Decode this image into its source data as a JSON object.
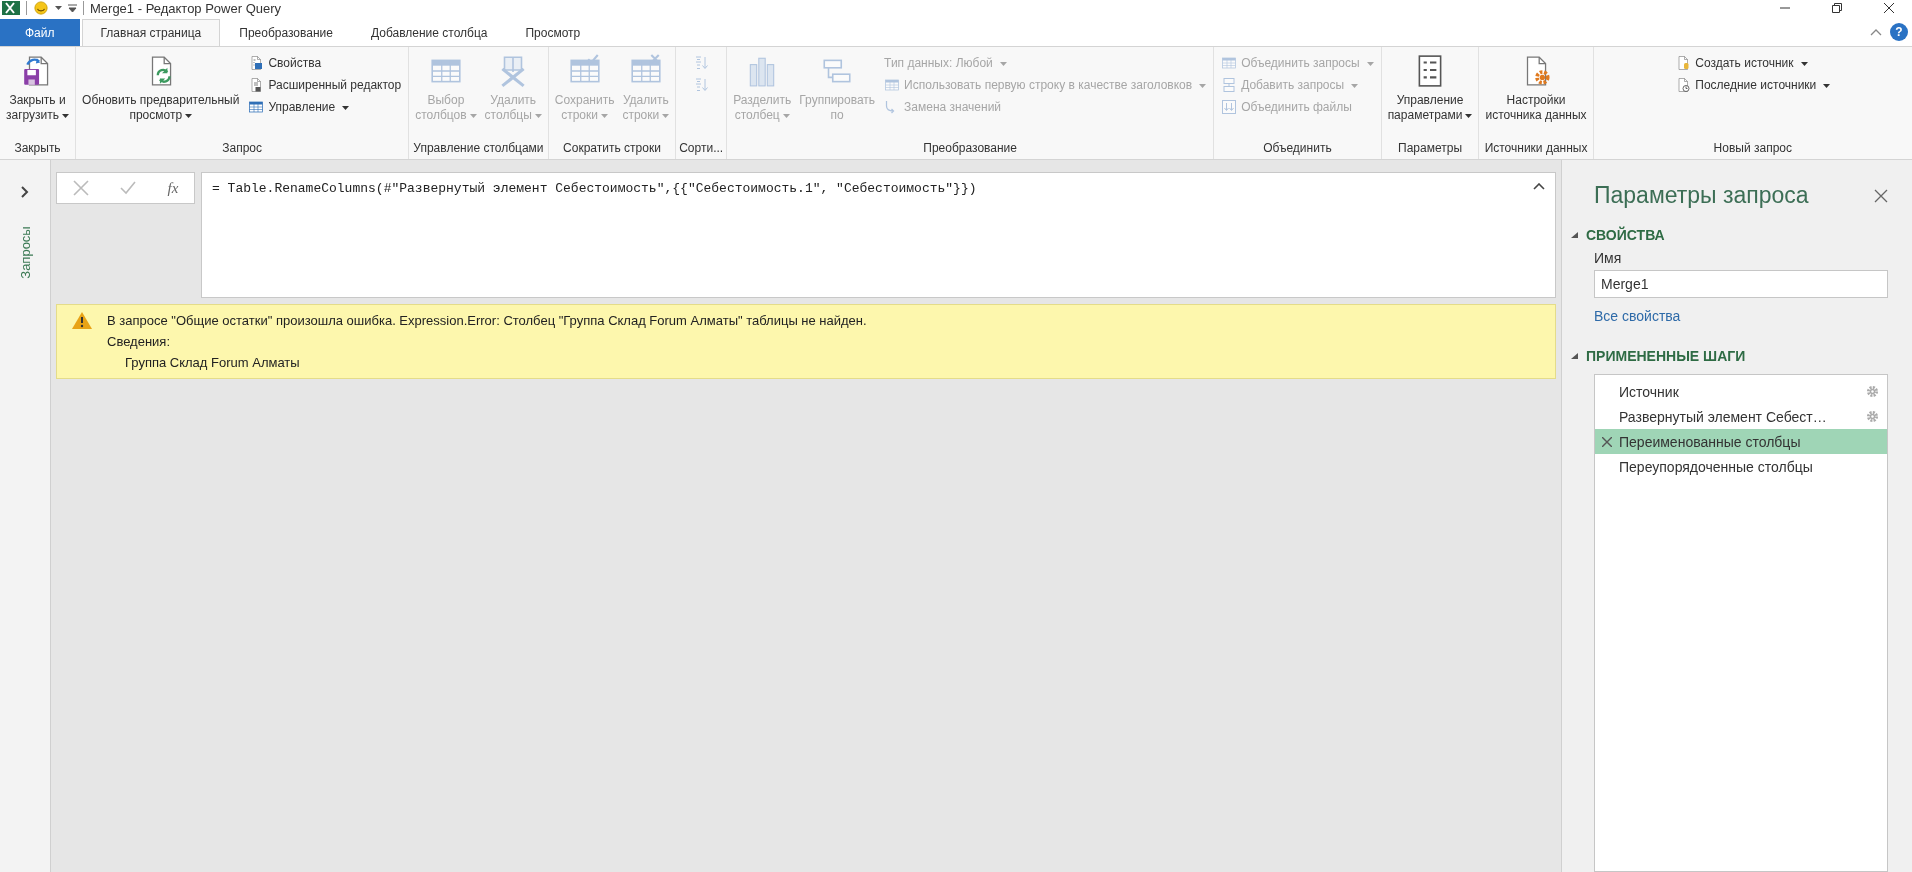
{
  "window": {
    "title": "Merge1 - Редактор Power Query",
    "help": "?"
  },
  "tabs": [
    {
      "label": "Файл",
      "kind": "file",
      "selected": false
    },
    {
      "label": "Главная страница",
      "kind": "tab",
      "selected": true
    },
    {
      "label": "Преобразование",
      "kind": "tab",
      "selected": false
    },
    {
      "label": "Добавление столбца",
      "kind": "tab",
      "selected": false
    },
    {
      "label": "Просмотр",
      "kind": "tab",
      "selected": false
    }
  ],
  "ribbon": {
    "groups": [
      {
        "label": "Закрыть",
        "items": [
          {
            "kind": "large",
            "label": "Закрыть и\nзагрузить",
            "dropdown": true,
            "disabled": false
          }
        ]
      },
      {
        "label": "Запрос",
        "items": [
          {
            "kind": "large",
            "label": "Обновить предварительный\nпросмотр",
            "dropdown": true,
            "disabled": false
          },
          {
            "kind": "stack",
            "items": [
              {
                "label": "Свойства",
                "dropdown": false,
                "disabled": false
              },
              {
                "label": "Расширенный редактор",
                "dropdown": false,
                "disabled": false
              },
              {
                "label": "Управление",
                "dropdown": true,
                "disabled": false
              }
            ]
          }
        ]
      },
      {
        "label": "Управление столбцами",
        "items": [
          {
            "kind": "large",
            "label": "Выбор\nстолбцов",
            "dropdown": true,
            "disabled": true
          },
          {
            "kind": "large",
            "label": "Удалить\nстолбцы",
            "dropdown": true,
            "disabled": true
          }
        ]
      },
      {
        "label": "Сократить строки",
        "items": [
          {
            "kind": "large",
            "label": "Сохранить\nстроки",
            "dropdown": true,
            "disabled": true
          },
          {
            "kind": "large",
            "label": "Удалить\nстроки",
            "dropdown": true,
            "disabled": true
          }
        ]
      },
      {
        "label": "Сорти...",
        "items": [
          {
            "kind": "stack",
            "items": [
              {
                "dropdown": false,
                "disabled": true
              },
              {
                "dropdown": false,
                "disabled": true
              }
            ]
          }
        ]
      },
      {
        "label": "Преобразование",
        "items": [
          {
            "kind": "large",
            "label": "Разделить\nстолбец",
            "dropdown": true,
            "disabled": true
          },
          {
            "kind": "large",
            "label": "Группировать\nпо",
            "dropdown": false,
            "disabled": true
          },
          {
            "kind": "stack",
            "items": [
              {
                "label": "Тип данных: Любой",
                "dropdown": true,
                "disabled": true
              },
              {
                "label": "Использовать первую строку в качестве заголовков",
                "dropdown": true,
                "disabled": true
              },
              {
                "label": "Замена значений",
                "dropdown": false,
                "disabled": true
              }
            ]
          }
        ]
      },
      {
        "label": "Объединить",
        "items": [
          {
            "kind": "stack",
            "items": [
              {
                "label": "Объединить запросы",
                "dropdown": true,
                "disabled": true
              },
              {
                "label": "Добавить запросы",
                "dropdown": true,
                "disabled": true
              },
              {
                "label": "Объединить файлы",
                "dropdown": false,
                "disabled": true
              }
            ]
          }
        ]
      },
      {
        "label": "Параметры",
        "items": [
          {
            "kind": "large",
            "label": "Управление\nпараметрами",
            "dropdown": true,
            "disabled": false
          }
        ]
      },
      {
        "label": "Источники данных",
        "items": [
          {
            "kind": "large",
            "label": "Настройки\nисточника данных",
            "dropdown": false,
            "disabled": false
          }
        ]
      },
      {
        "label": "Новый запрос",
        "items": [
          {
            "kind": "stack",
            "items": [
              {
                "label": "Создать источник",
                "dropdown": true,
                "disabled": false
              },
              {
                "label": "Последние источники",
                "dropdown": true,
                "disabled": false
              }
            ]
          }
        ]
      }
    ]
  },
  "queries_pane": {
    "label": "Запросы"
  },
  "formula_bar": {
    "fx": "fx",
    "formula": "= Table.RenameColumns(#\"Развернутый элемент Себестоимость\",{{\"Себестоимость.1\", \"Себестоимость\"}})"
  },
  "error": {
    "message": "В запросе \"Общие остатки\" произошла ошибка. Expression.Error: Столбец \"Группа Склад Forum Алматы\" таблицы не найден.",
    "details_label": "Сведения:",
    "detail": "Группа Склад Forum Алматы"
  },
  "query_settings": {
    "title": "Параметры запроса",
    "properties": {
      "heading": "СВОЙСТВА",
      "name_label": "Имя",
      "name_value": "Merge1",
      "all_properties": "Все свойства"
    },
    "applied_steps": {
      "heading": "ПРИМЕНЕННЫЕ ШАГИ",
      "steps": [
        {
          "name": "Источник",
          "settings": true,
          "selected": false
        },
        {
          "name": "Развернутый элемент Себест…",
          "settings": true,
          "selected": false
        },
        {
          "name": "Переименованные столбцы",
          "settings": false,
          "selected": true
        },
        {
          "name": "Переупорядоченные столбцы",
          "settings": false,
          "selected": false
        }
      ]
    }
  }
}
